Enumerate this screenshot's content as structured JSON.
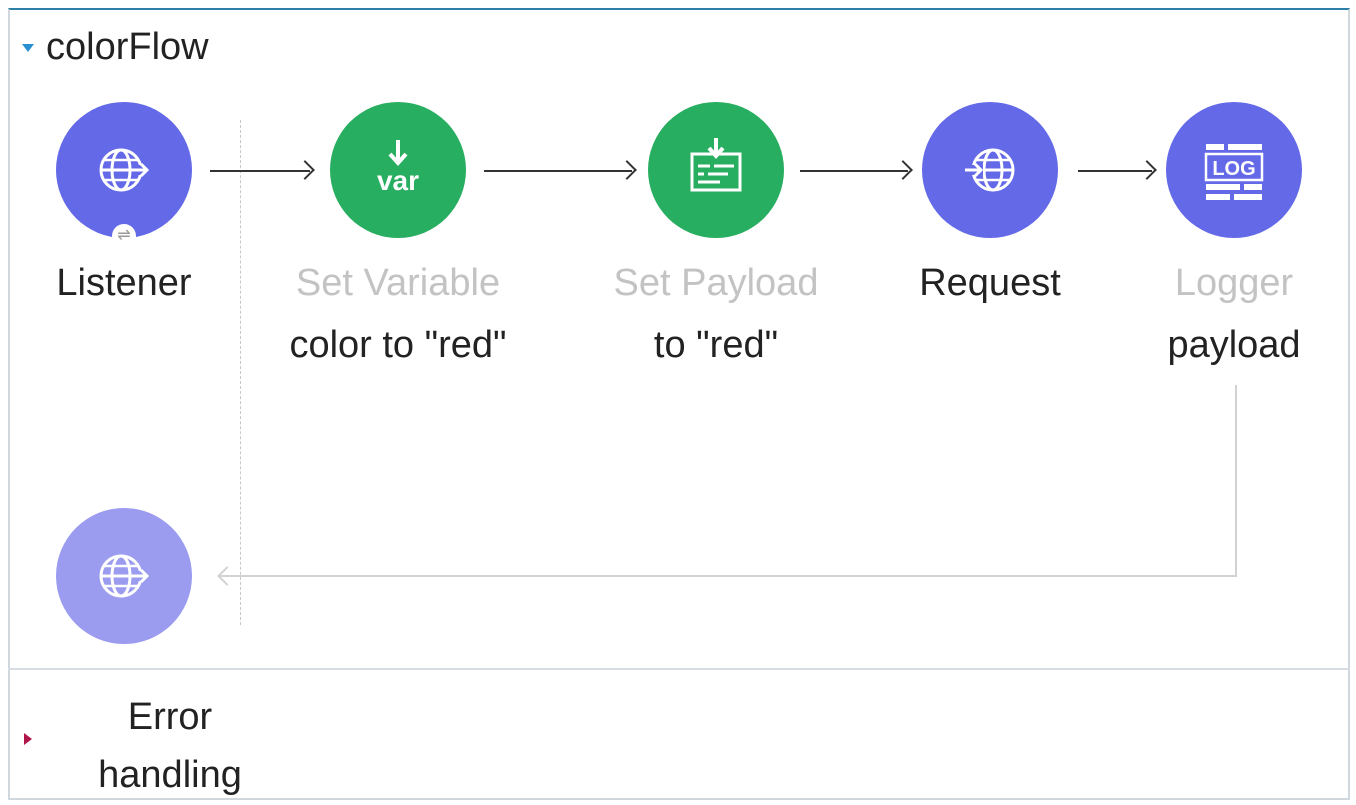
{
  "flow": {
    "title": "colorFlow"
  },
  "components": [
    {
      "id": "listener",
      "name": "Listener",
      "sub": "",
      "icon": "globe-arrow-icon"
    },
    {
      "id": "set-variable",
      "name": "Set Variable",
      "sub": "color to \"red\"",
      "icon": "var-icon"
    },
    {
      "id": "set-payload",
      "name": "Set Payload",
      "sub": "to \"red\"",
      "icon": "set-payload-icon"
    },
    {
      "id": "request",
      "name": "Request",
      "sub": "",
      "icon": "globe-arrow-icon"
    },
    {
      "id": "logger",
      "name": "Logger",
      "sub": "payload",
      "icon": "log-icon"
    }
  ],
  "icons": {
    "var_text": "var",
    "log_text": "LOG"
  },
  "error_handling": {
    "label": "Error handling"
  },
  "colors": {
    "blue": "#6469e8",
    "green": "#27ae60",
    "lavender": "#9b9cf0",
    "accent": "#2e7fa8",
    "error_triangle": "#b0154a"
  }
}
